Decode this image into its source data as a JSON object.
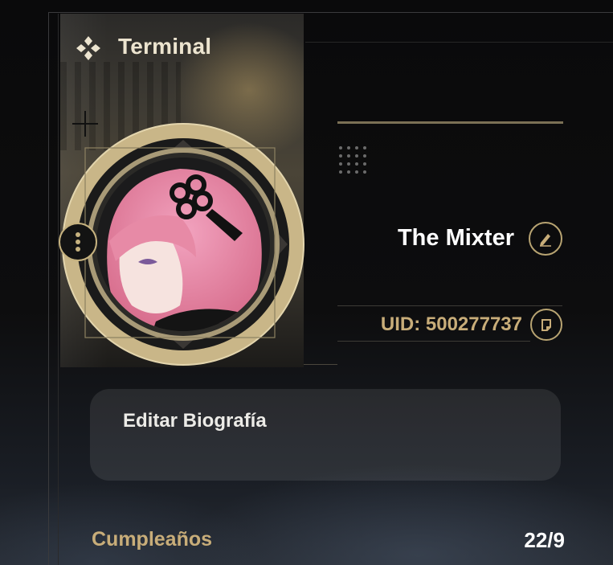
{
  "header": {
    "title": "Terminal",
    "icon": "terminal-diamond-icon"
  },
  "profile": {
    "name": "The Mixter",
    "uid": "UID: 500277737",
    "edit_icon": "pencil-icon",
    "copy_icon": "copy-icon",
    "menu_icon": "more-vertical-icon"
  },
  "bio": {
    "label": "Editar Biografía"
  },
  "birthday": {
    "label": "Cumpleaños",
    "value": "22/9"
  },
  "colors": {
    "accent_gold": "#c8ad79",
    "ring_gold": "#c6b27f",
    "background": "#0b0b0c"
  }
}
